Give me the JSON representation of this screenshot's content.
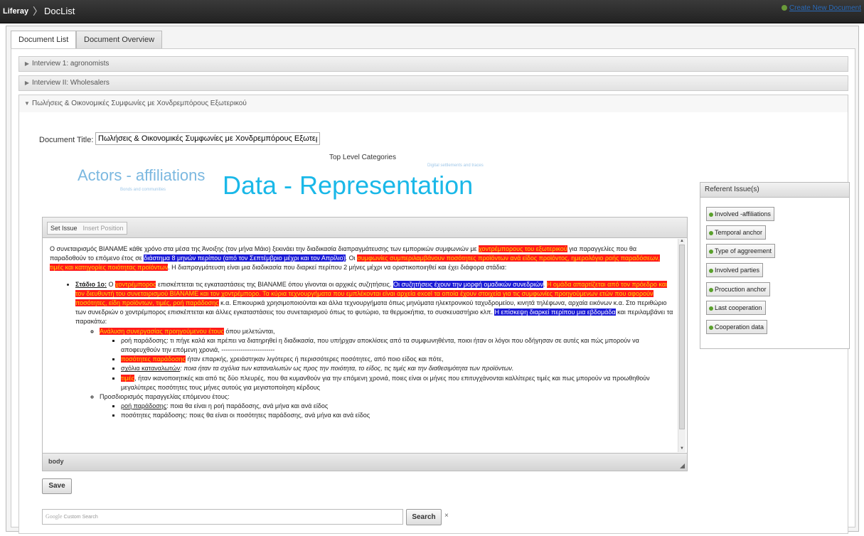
{
  "topbar": {
    "brand": "Liferay",
    "crumb": "DocList",
    "create_link": "Create New Document"
  },
  "tabs": [
    "Document List",
    "Document Overview"
  ],
  "accordion": [
    {
      "label": "Interview 1: agronomists",
      "expanded": false
    },
    {
      "label": "Interview II: Wholesalers",
      "expanded": false
    },
    {
      "label": "Πωλήσεις & Οικονομικές Συμφωνίες με Χονδρεμπόρους Εξωτερικού",
      "expanded": true
    }
  ],
  "document": {
    "title_label": "Document Title:",
    "title_value": "Πωλήσεις & Οικονομικές Συμφωνίες με Χονδρεμπόρους Εξωτερικού"
  },
  "categories": {
    "heading": "Top Level Categories",
    "tags": {
      "big": "Data - Representation",
      "medium": "Actors - affiliations",
      "small1": "Digital settlements and traces",
      "small2": "Bonds and communities"
    }
  },
  "editor": {
    "toolbar": {
      "set_issue": "Set Issue",
      "insert_position": "Insert Position"
    },
    "footer_path": "body",
    "para1": {
      "t1": "Ο συνεταιρισμός ΒΙΑΝΑΜΕ κάθε χρόνο στα μέσα της Άνοιξης (τον μήνα Μάιο) ξεκινάει την διαδικασία διαπραγμάτευσης των εμπορικών συμφωνιών με ",
      "h1": "χοντρέμπορους του εξωτερικού",
      "t2": " για παραγγελίες που θα παραδοθούν το επόμενο έτος σε ",
      "b1": "διάστημα 8 μηνών περίπου (από τον Σεπτέμβριο μέχρι και τον Απρίλιο)",
      "t3": ". Οι ",
      "h2": "συμφωνίες συμπεριλαμβάνουν ποσότητες προϊόντων ανά είδος προϊόντος, ημερολόγιο ροής παραδόσεων, τιμές και κατηγορίες ποιότητας προϊόντων",
      "t4": ". Η διαπραγμάτευση είναι μια διαδικασία που διαρκεί περίπου 2 μήνες μέχρι να οριστικοποιηθεί και έχει διάφορα στάδια:"
    },
    "stage1": {
      "label": "Στάδιο 1ο:",
      "t1": " Ο ",
      "h1": "χοντρέμπορος",
      "t2": " επισκέπτεται τις εγκαταστάσεις της ΒΙΑΝΑΜΕ όπου γίνονται οι αρχικές  συζητήσεις. ",
      "b1": "Οι συζητήσεις έχουν την μορφή ομαδικών συνεδριών",
      "t3": ". ",
      "h2": "Η ομάδα απαρτίζεται από τον πρόεδρο και τον διευθυντή του συνεταιρισμού ΒΙΑΝΑΜΕ και τον χοντρέμπορο. Τα κύρια τεχνουργήματα που εμπλέκονται είναι αρχεία excel τα οποία έχουν στοιχεία για τις συμφωνίες προηγούμενων ετών που αφορούν ποσότητες, είδη προϊόντων, τιμές, ροή παράδοσης",
      "t4": " κ.α. Επικουρικά χρησιμοποιούνται και άλλα τεχνουργήματα όπως μηνύματα ηλεκτρονικού ταχυδρομείου, κινητά τηλέφωνα, αρχαία εικόνων κ.α. Στο περιθώριο των συνεδριών ο χοντρέμπορος επισκέπτεται και άλλες εγκαταστάσεις του συνεταιρισμού όπως το φυτώριο, τα θερμοκήπια, το συσκευαστήριο κλπ. ",
      "b2": "Η επίσκεψη διαρκεί περίπου μια εβδομάδα",
      "t5": " και περιλαμβάνει τα παρακάτω:"
    },
    "analysis": {
      "h1": "Ανάλυση συνεργασίας προηγούμενου έτους",
      "t1": " όπου μελετώνται,",
      "items": [
        {
          "lead": "",
          "leadStyle": "",
          "text": "ροή παράδοσης: τι πήγε καλά και πρέπει να διατηρηθεί η διαδικασία, που υπήρχαν αποκλίσεις από τα συμφωνηθέντα, ποιοι ήταν οι λόγοι που οδήγησαν σε αυτές και πώς μπορούν να αποφευχθούν την επόμενη χρονιά,  -------------------------"
        },
        {
          "lead": "ποσότητες παράδοσης",
          "leadStyle": "hy",
          "text": " ήταν επαρκής, χρειάστηκαν λιγότερες ή περισσότερες ποσότητες, από ποιο είδος και πότε,"
        },
        {
          "lead": "σχόλια καταναλωτών",
          "leadStyle": "u",
          "text": ": ποια ήταν τα σχόλια των καταναλωτών ως προς την ποιότητα, το είδος, τις τιμές και την διαθεσιμότητα των προϊόντων.",
          "italic": true
        },
        {
          "lead": "τιμές",
          "leadStyle": "hy",
          "text": ", ήταν ικανοποιητικές και από τις δύο πλευρές, που θα κυμανθούν για την επόμενη χρονιά, ποιες είναι οι μήνες που επιτυγχάνονται καλλίτερες τιμές και πως μπορούν να προωθηθούν μεγαλύτερες ποσότητες τους μήνες αυτούς για μεγιστοποίηση κέρδους"
        }
      ]
    },
    "forecast": {
      "label": "Προσδιορισμός παραγγελίας επόμενου έτους:",
      "items": [
        {
          "lead": "ροή παράδοσης",
          "text": ": ποια θα είναι η ροή παράδοσης, ανά μήνα και ανά είδος"
        },
        {
          "lead": "",
          "text": "ποσότητες παράδοσης: ποιες θα είναι οι ποσότητες παράδοσης, ανά μήνα και ανά είδος"
        }
      ]
    }
  },
  "save_label": "Save",
  "search": {
    "google": "Google",
    "custom": "Custom Search",
    "button": "Search",
    "close": "×"
  },
  "referent": {
    "header": "Referent Issue(s)",
    "items": [
      "Involved -affiliations",
      "Temporal anchor",
      "Type of aggreement",
      "Involved parties",
      "Procuction anchor",
      "Last cooperation",
      "Cooperation data"
    ]
  }
}
